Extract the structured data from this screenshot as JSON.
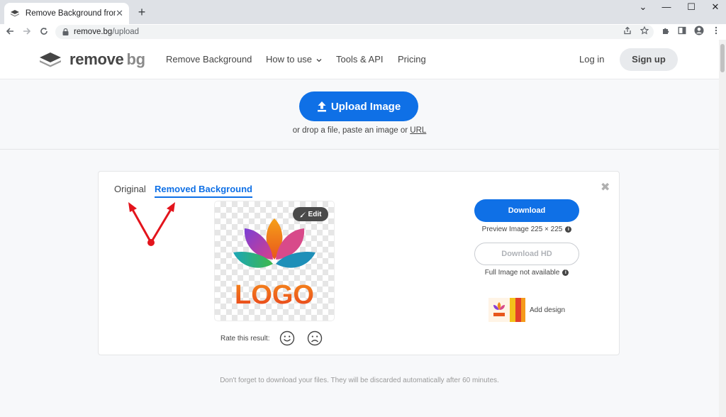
{
  "browser": {
    "tab_title": "Remove Background from Image",
    "tab_close": "✕",
    "new_tab": "+",
    "url_host": "remove.bg",
    "url_path": "/upload",
    "window_controls": [
      "⌄",
      "—",
      "☐",
      "✕"
    ]
  },
  "header": {
    "logo_word": "remove",
    "logo_bg": "bg",
    "nav": [
      "Remove Background",
      "How to use",
      "Tools & API",
      "Pricing"
    ],
    "login": "Log in",
    "signup": "Sign up"
  },
  "upload": {
    "button": "Upload Image",
    "hint_prefix": "or drop a file, paste an image or ",
    "hint_link": "URL"
  },
  "result": {
    "tab_original": "Original",
    "tab_removed": "Removed Background",
    "close": "✖",
    "edit": "Edit",
    "logo_text": "LOGO",
    "rate_label": "Rate this result:",
    "download": "Download",
    "preview_info": "Preview Image 225 × 225",
    "download_hd": "Download HD",
    "full_info": "Full Image not available",
    "add_design": "Add design",
    "info_glyph": "i"
  },
  "footer": {
    "note": "Don't forget to download your files. They will be discarded automatically after 60 minutes."
  },
  "colors": {
    "accent": "#0f70e6",
    "annotation_arrows": "#e3141c"
  }
}
